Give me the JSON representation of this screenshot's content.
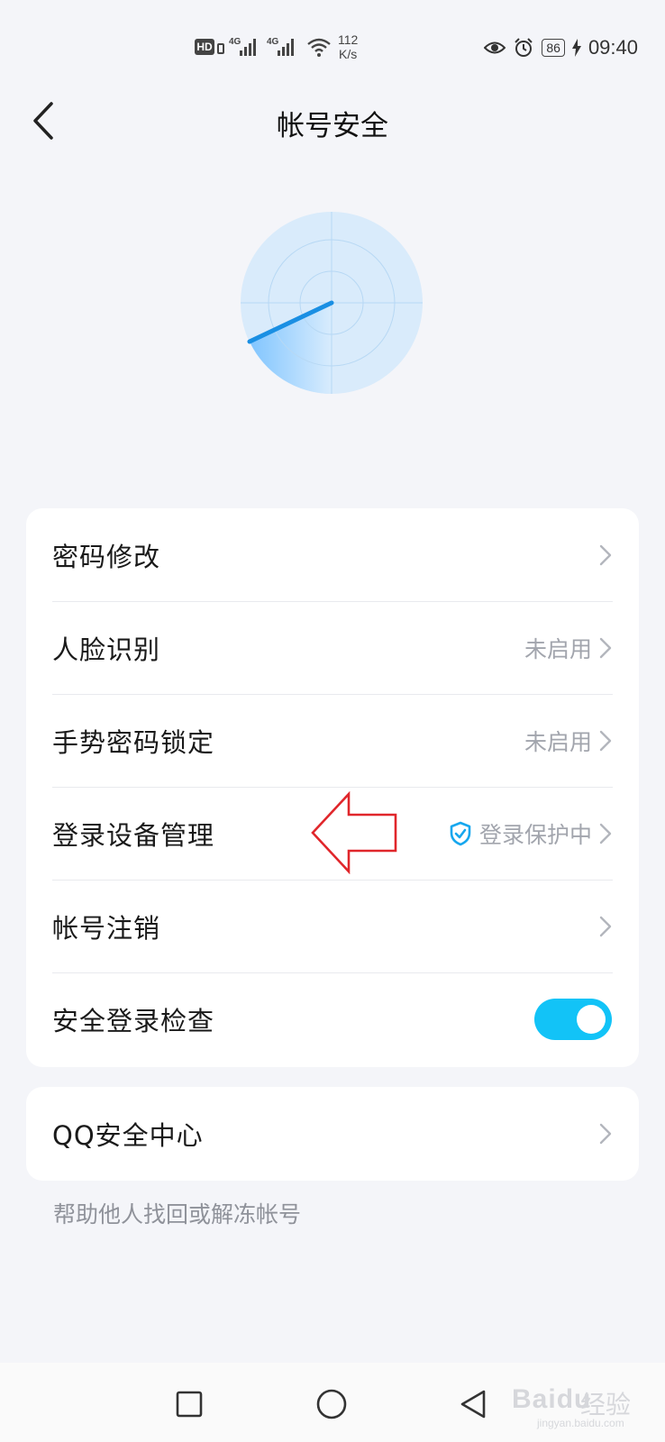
{
  "status_bar": {
    "hd": "HD",
    "network_1": "4G",
    "network_2": "4G",
    "speed_value": "112",
    "speed_unit": "K/s",
    "battery": "86",
    "time": "09:40",
    "icons": [
      "hd-icon",
      "signal-icon",
      "wifi-icon",
      "eye-icon",
      "alarm-icon",
      "battery-icon",
      "charging-icon"
    ]
  },
  "header": {
    "title": "帐号安全",
    "back_icon": "back-chevron-icon"
  },
  "radar": {
    "icon": "radar-scan-icon",
    "accent": "#1a8fe3"
  },
  "main_card": {
    "rows": [
      {
        "label": "密码修改",
        "status": ""
      },
      {
        "label": "人脸识别",
        "status": "未启用"
      },
      {
        "label": "手势密码锁定",
        "status": "未启用"
      },
      {
        "label": "登录设备管理",
        "status": "登录保护中",
        "status_icon": "shield-check-icon"
      },
      {
        "label": "帐号注销",
        "status": ""
      },
      {
        "label": "安全登录检查",
        "toggle": true,
        "toggle_on": true
      }
    ]
  },
  "qq_card": {
    "label": "QQ安全中心"
  },
  "help_link": "帮助他人找回或解冻帐号",
  "annotation": {
    "icon": "red-outline-arrow-icon",
    "color": "#e0262b"
  },
  "bottom_nav": {
    "icons": [
      "square-recent-icon",
      "circle-home-icon",
      "triangle-back-icon"
    ]
  },
  "watermark": {
    "brand": "Bai",
    "brand2": "du",
    "text": "经验",
    "sub": "jingyan.baidu.com"
  },
  "colors": {
    "toggle_on": "#12c3f7",
    "background": "#f4f5f9",
    "card": "#ffffff",
    "muted_text": "#a2a5ad"
  }
}
